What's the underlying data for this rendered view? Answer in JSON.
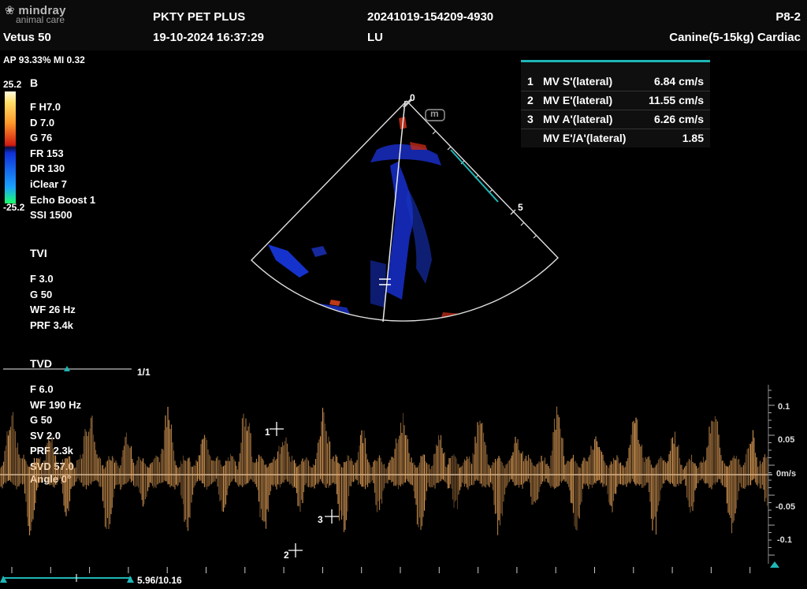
{
  "header": {
    "brand": "mindray",
    "brand_sub": "animal care",
    "device": "Vetus 50",
    "hospital": "PKTY PET PLUS",
    "datetime": "19-10-2024  16:37:29",
    "exam_id": "20241019-154209-4930",
    "operator": "LU",
    "probe": "P8-2",
    "preset": "Canine(5-15kg) Cardiac"
  },
  "status": {
    "ap_mi": "AP 93.33%  MI 0.32"
  },
  "color_scale": {
    "max": "25.2",
    "min": "-25.2"
  },
  "b_mode": {
    "label": "B",
    "params": [
      "F H7.0",
      "D 7.0",
      "G 76",
      "FR 153",
      "DR 130",
      "iClear 7",
      "Echo Boost 1",
      "SSI 1500"
    ]
  },
  "tvi": {
    "label": "TVI",
    "params": [
      "F 3.0",
      "G 50",
      "WF 26 Hz",
      "PRF 3.4k"
    ]
  },
  "tvd": {
    "label": "TVD",
    "params": [
      "F 6.0",
      "WF 190 Hz",
      "G 50",
      "SV 2.0",
      "PRF 2.3k",
      "SVD 57.0",
      "Angle    0°"
    ]
  },
  "page_indicator": "1/1",
  "cine_position": "5.96/10.16",
  "measurements": [
    {
      "num": "1",
      "label": "MV S'(lateral)",
      "value": "6.84 cm/s"
    },
    {
      "num": "2",
      "label": "MV E'(lateral)",
      "value": "11.55 cm/s"
    },
    {
      "num": "3",
      "label": "MV A'(lateral)",
      "value": "6.26 cm/s"
    },
    {
      "num": "",
      "label": "MV E'/A'(lateral)",
      "value": "1.85"
    }
  ],
  "sector": {
    "depth_start": "0",
    "depth_mid": "5",
    "marker": "m"
  },
  "velocity_scale": {
    "ticks": [
      "0.1",
      "0.05",
      "0m/s",
      "-0.05",
      "-0.1"
    ]
  },
  "markers": [
    "1",
    "2",
    "3"
  ],
  "colors": {
    "accent": "#1fb7b7",
    "doppler": "#e8a45a",
    "flow_blue": "#1a3cff",
    "flow_red": "#d0301a"
  }
}
